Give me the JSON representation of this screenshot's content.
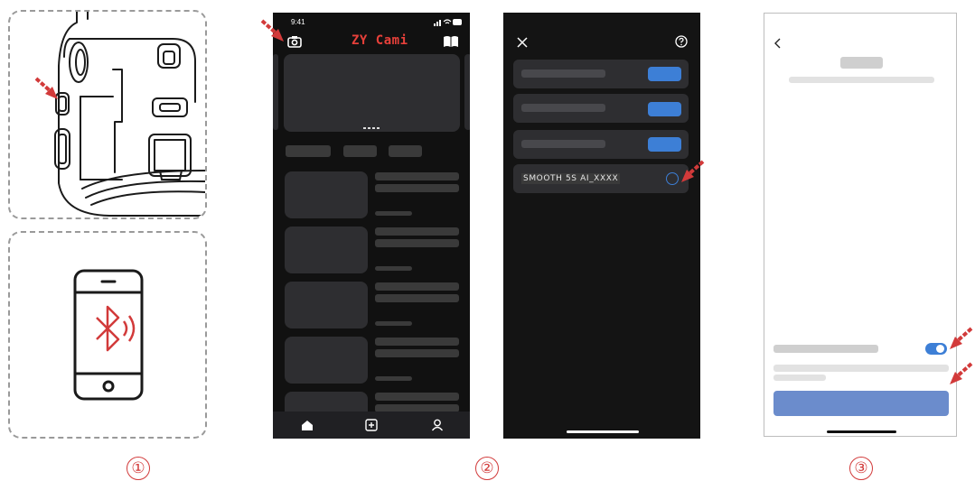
{
  "panel1": {
    "step_number": "①"
  },
  "panel2": {
    "step_number": "②",
    "home": {
      "time": "9:41",
      "app_title": "ZY Cami",
      "camera_icon": "camera-icon",
      "book_icon": "book-icon",
      "nav_icons": [
        "home-icon",
        "add-icon",
        "profile-icon"
      ]
    },
    "devices": {
      "close_icon": "close-icon",
      "help_icon": "help-icon",
      "device_label": "SMOOTH 5S AI_XXXX"
    }
  },
  "panel3": {
    "step_number": "③",
    "back_icon": "back-icon"
  },
  "colors": {
    "arrow_red": "#d23a3a",
    "app_red": "#e7403a",
    "blue": "#3d7fd6",
    "confirm_blue": "#6b8ccc"
  }
}
